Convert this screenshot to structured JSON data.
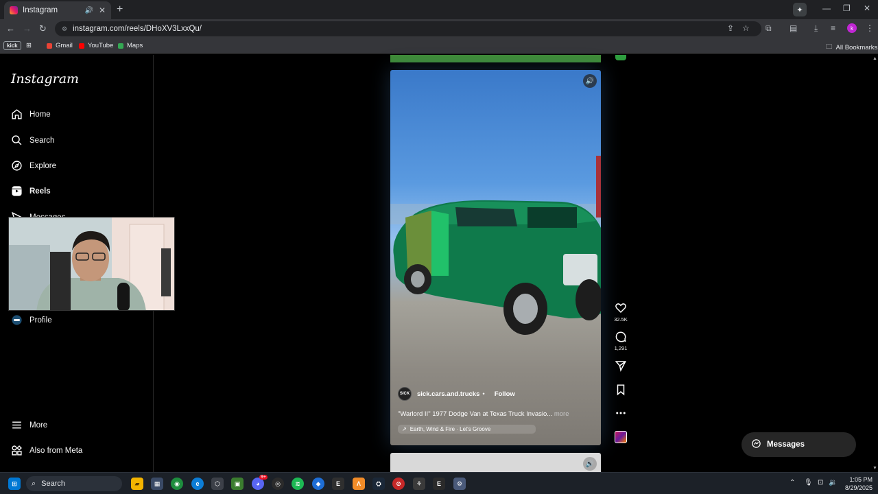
{
  "browser": {
    "tab_title": "Instagram",
    "url": "instagram.com/reels/DHoXV3LxxQu/",
    "bookmarks": [
      {
        "label": "Gmail",
        "color": "#ea4335"
      },
      {
        "label": "YouTube",
        "color": "#ff0000"
      },
      {
        "label": "Maps",
        "color": "#34a853"
      }
    ],
    "kick_label": "kick",
    "all_bookmarks": "All Bookmarks",
    "profile_initial": "k"
  },
  "instagram": {
    "logo": "Instagram",
    "nav": {
      "home": "Home",
      "search": "Search",
      "explore": "Explore",
      "reels": "Reels",
      "messages": "Messages",
      "profile": "Profile",
      "more": "More",
      "meta": "Also from Meta"
    },
    "reel": {
      "author": "sick.cars.and.trucks",
      "separator": "•",
      "follow": "Follow",
      "avatar_text": "SICK",
      "caption": "\"Warlord II\" 1977 Dodge Van at Texas Truck Invasio...",
      "more": "more",
      "audio": "Earth, Wind & Fire · Let's Groove",
      "likes": "32.5K",
      "comments": "1,291"
    },
    "messages_pill": "Messages"
  },
  "taskbar": {
    "search_placeholder": "Search",
    "time": "1:05 PM",
    "date": "8/29/2025",
    "discord_badge": "9+"
  },
  "colors": {
    "instagram_bg": "#000000",
    "accent_green": "#3f8b37",
    "van_green": "#0f7a4b"
  }
}
